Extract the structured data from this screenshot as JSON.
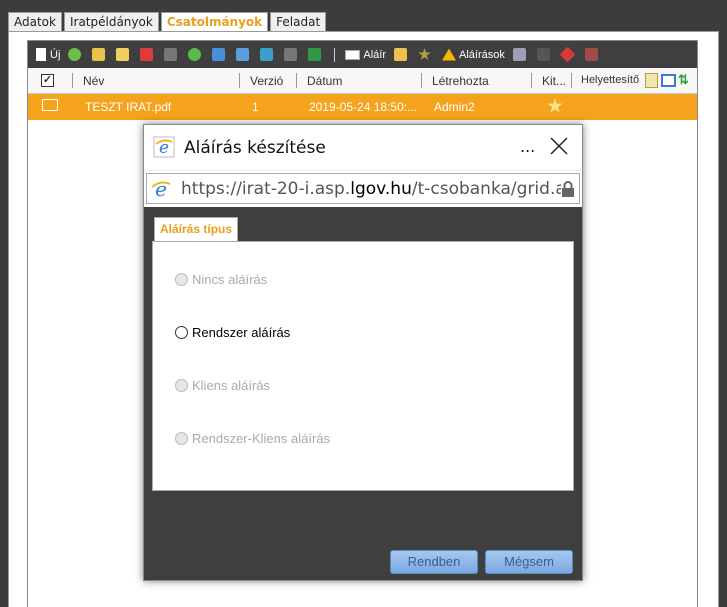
{
  "tabs": [
    {
      "label": "Adatok"
    },
    {
      "label": "Iratpéldányok"
    },
    {
      "label": "Csatolmányok"
    },
    {
      "label": "Feladat"
    }
  ],
  "toolbar": {
    "new_label": "Új",
    "sign_label": "Aláír",
    "signatures_label": "Aláírások"
  },
  "grid": {
    "columns": [
      "Név",
      "Verzió",
      "Dátum",
      "Létrehozta",
      "Kit...",
      "Helyettesítő"
    ],
    "rows": [
      {
        "name": "TESZT IRAT.pdf",
        "version": "1",
        "date": "2019-05-24 18:50:...",
        "created_by": "Admin2"
      }
    ]
  },
  "dialog": {
    "title": "Aláírás készítése",
    "more": "...",
    "url_prefix": "https://irat-20-i.asp.",
    "url_domain": "lgov.hu",
    "url_suffix": "/t-csobanka/grid.ac",
    "tab_label": "Aláírás típus",
    "options": [
      {
        "label": "Nincs aláírás",
        "enabled": false
      },
      {
        "label": "Rendszer aláírás",
        "enabled": true
      },
      {
        "label": "Kliens aláírás",
        "enabled": false
      },
      {
        "label": "Rendszer-Kliens aláírás",
        "enabled": false
      }
    ],
    "ok_label": "Rendben",
    "cancel_label": "Mégsem"
  },
  "colors": {
    "accent_orange": "#f5a21d",
    "toolbar_bg": "#3f3f3f",
    "tab_active_text": "#e8a020"
  }
}
